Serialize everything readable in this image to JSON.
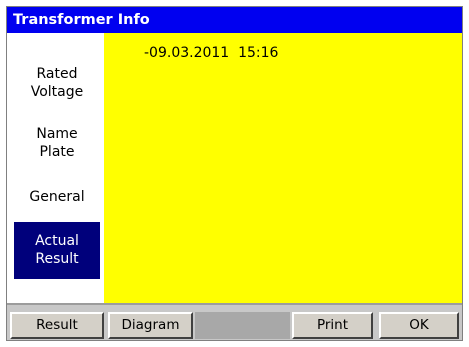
{
  "window": {
    "title": "Transformer Info"
  },
  "sidebar": {
    "items": [
      {
        "label_line1": "Rated",
        "label_line2": "Voltage"
      },
      {
        "label_line1": "Name",
        "label_line2": "Plate"
      },
      {
        "label_line1": "General"
      },
      {
        "label_line1": "Actual",
        "label_line2": "Result"
      }
    ]
  },
  "content": {
    "datetime": "-09.03.2011  15:16"
  },
  "buttons": {
    "result": "Result",
    "diagram": "Diagram",
    "print": "Print",
    "ok": "OK"
  },
  "colors": {
    "title_bg": "#0000f0",
    "content_bg": "#ffff00",
    "active_bg": "#00007b"
  }
}
